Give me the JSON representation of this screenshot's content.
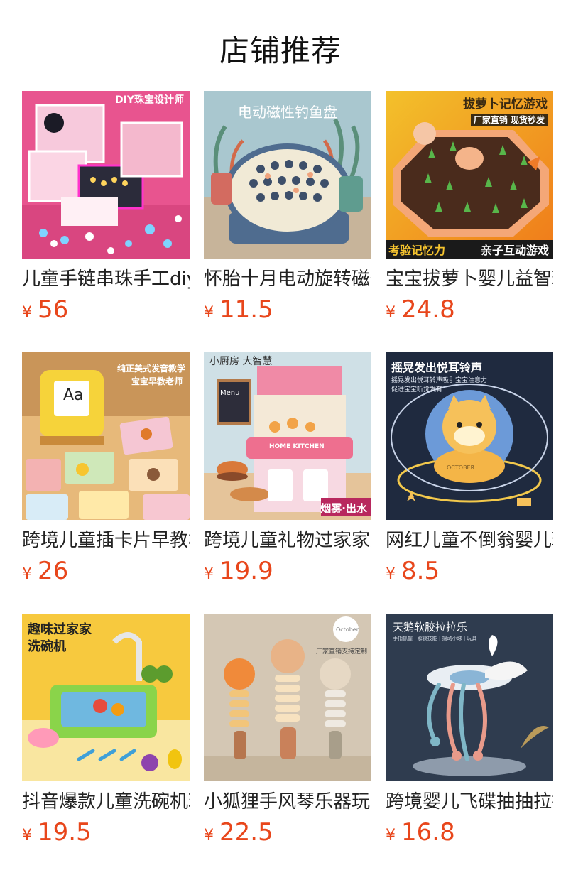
{
  "section": {
    "title": "店铺推荐"
  },
  "products": [
    {
      "name": "儿童手链串珠手工diy",
      "currency": "¥",
      "price": "56",
      "image_text": [
        "DIY珠宝设计师"
      ]
    },
    {
      "name": "怀胎十月电动旋转磁性",
      "currency": "¥",
      "price": "11.5",
      "image_text": [
        "电动磁性钓鱼盘"
      ]
    },
    {
      "name": "宝宝拔萝卜婴儿益智玩",
      "currency": "¥",
      "price": "24.8",
      "image_text": [
        "拔萝卜记忆游戏",
        "厂家直销 现货秒发",
        "考验记忆力",
        "亲子互动游戏"
      ]
    },
    {
      "name": "跨境儿童插卡片早教机",
      "currency": "¥",
      "price": "26",
      "image_text": [
        "纯正美式发音教学",
        "宝宝早教老师",
        "Aa"
      ]
    },
    {
      "name": "跨境儿童礼物过家家厨",
      "currency": "¥",
      "price": "19.9",
      "image_text": [
        "小厨房 大智慧",
        "Menu",
        "HOME KITCHEN",
        "烟雾·出水"
      ]
    },
    {
      "name": "网红儿童不倒翁婴儿玩",
      "currency": "¥",
      "price": "8.5",
      "image_text": [
        "摇晃发出悦耳铃声",
        "摇晃发出悦耳铃声吸引宝宝注意力",
        "促进宝宝听觉发育",
        "OCTOBER"
      ]
    },
    {
      "name": "抖音爆款儿童洗碗机玩",
      "currency": "¥",
      "price": "19.5",
      "image_text": [
        "趣味过家家",
        "洗碗机"
      ]
    },
    {
      "name": "小狐狸手风琴乐器玩具",
      "currency": "¥",
      "price": "22.5",
      "image_text": [
        "October",
        "厂家直销支持定制"
      ]
    },
    {
      "name": "跨境婴儿飞碟抽抽拉拉",
      "currency": "¥",
      "price": "16.8",
      "image_text": [
        "天鹅软胶拉拉乐",
        "手指抓握 | 解锁技能 | 摇动小球 | 玩具"
      ]
    }
  ]
}
